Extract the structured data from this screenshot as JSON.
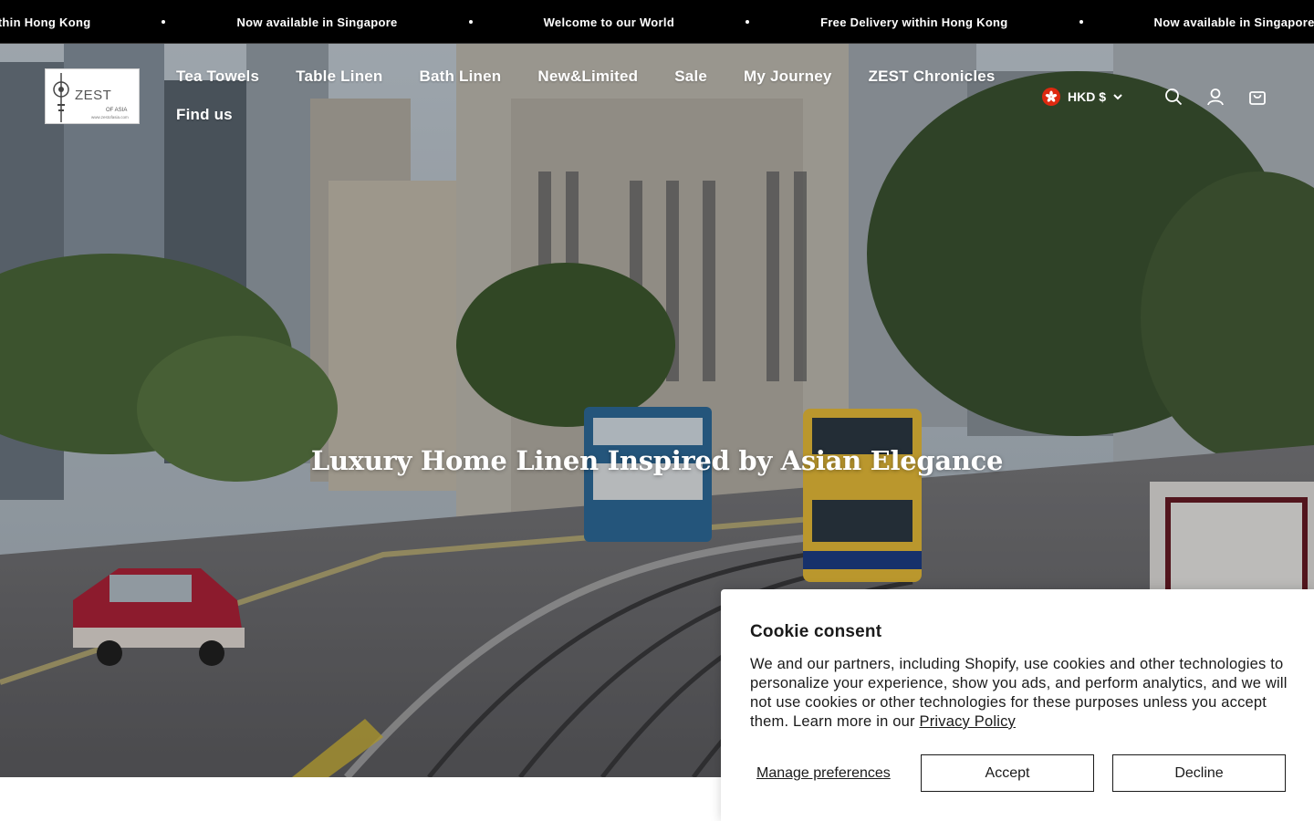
{
  "announcement": {
    "items": [
      "Free Delivery within Hong Kong",
      "Now available in Singapore",
      "Welcome to our World",
      "Free Delivery within Hong Kong",
      "Now available in Singapore"
    ]
  },
  "logo": {
    "brand": "ZEST",
    "sub": "OF ASIA",
    "url": "www.zestofasia.com"
  },
  "nav": {
    "items": [
      "Tea Towels",
      "Table Linen",
      "Bath Linen",
      "New&Limited",
      "Sale",
      "My Journey",
      "ZEST Chronicles",
      "Find us"
    ]
  },
  "header": {
    "currency": "HKD $",
    "icons": [
      "search-icon",
      "account-icon",
      "cart-icon"
    ]
  },
  "hero": {
    "title": "Luxury Home Linen Inspired by Asian Elegance"
  },
  "cookie": {
    "title": "Cookie consent",
    "body": "We and our partners, including Shopify, use cookies and other technologies to personalize your experience, show you ads, and perform analytics, and we will not use cookies or other technologies for these purposes unless you accept them. Learn more in our ",
    "privacy_link": "Privacy Policy",
    "manage_label": "Manage preferences",
    "accept_label": "Accept",
    "decline_label": "Decline"
  },
  "colors": {
    "announcement_bg": "#000000",
    "flag_red": "#de2910",
    "text_dark": "#1a1a1a"
  }
}
